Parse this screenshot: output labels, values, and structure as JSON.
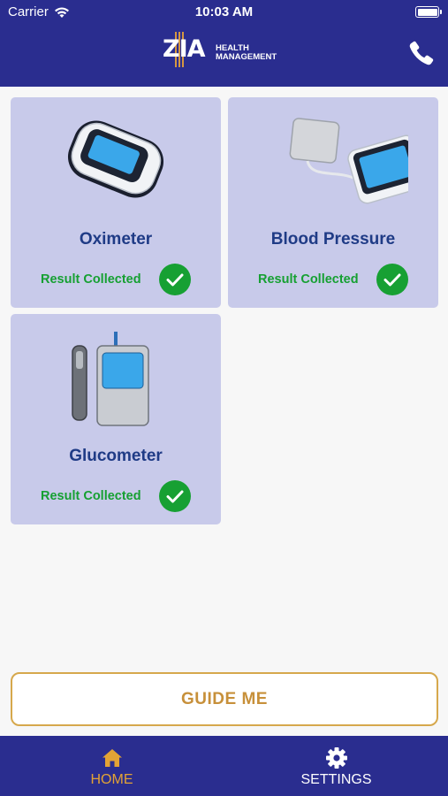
{
  "status_bar": {
    "carrier": "Carrier",
    "time": "10:03 AM"
  },
  "header": {
    "logo_mark": "ZIA",
    "logo_line1": "HEALTH",
    "logo_line2": "MANAGEMENT",
    "phone_icon": "phone-icon"
  },
  "devices": [
    {
      "name": "Oximeter",
      "status": "Result Collected",
      "icon": "pulse-oximeter-image"
    },
    {
      "name": "Blood Pressure",
      "status": "Result Collected",
      "icon": "blood-pressure-monitor-image"
    },
    {
      "name": "Glucometer",
      "status": "Result Collected",
      "icon": "glucometer-image"
    }
  ],
  "guide_button": "GUIDE ME",
  "tabs": [
    {
      "label": "HOME",
      "icon": "home-icon",
      "active": true
    },
    {
      "label": "SETTINGS",
      "icon": "gear-icon",
      "active": false
    }
  ],
  "colors": {
    "header_bg": "#2a2d8f",
    "card_bg": "#c8caea",
    "device_name": "#1f3b86",
    "success": "#17a033",
    "accent": "#d6a84c"
  }
}
